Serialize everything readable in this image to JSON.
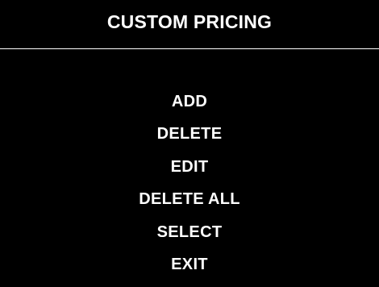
{
  "title": "CUSTOM PRICING",
  "menu": {
    "items": [
      {
        "label": "ADD"
      },
      {
        "label": "DELETE"
      },
      {
        "label": "EDIT"
      },
      {
        "label": "DELETE ALL"
      },
      {
        "label": "SELECT"
      },
      {
        "label": "EXIT"
      }
    ]
  },
  "colors": {
    "background": "#000000",
    "text": "#ffffff",
    "divider": "#ffffff"
  }
}
